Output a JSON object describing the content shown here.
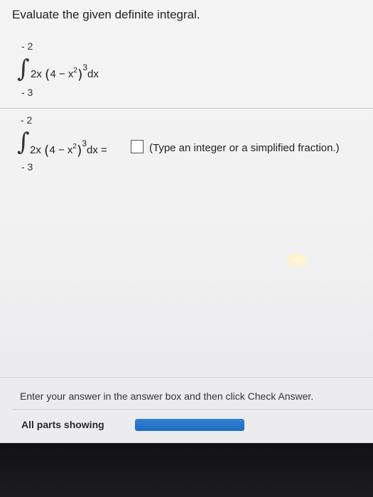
{
  "prompt": "Evaluate the given definite integral.",
  "problem": {
    "upper_limit": "- 2",
    "lower_limit": "- 3",
    "coefficient": "2x",
    "open_paren": "(",
    "inner": "4 − x",
    "inner_exponent": "2",
    "close_paren": ")",
    "outer_exponent": "3",
    "differential": "dx"
  },
  "answer_line": {
    "upper_limit": "- 2",
    "lower_limit": "- 3",
    "coefficient": "2x",
    "open_paren": "(",
    "inner": "4 − x",
    "inner_exponent": "2",
    "close_paren": ")",
    "outer_exponent": "3",
    "differential": "dx =",
    "answer_value": "",
    "hint": "(Type an integer or a simplified fraction.)"
  },
  "footer": {
    "instruction": "Enter your answer in the answer box and then click Check Answer.",
    "parts_label": "All parts showing",
    "progress": 1.0,
    "progress_color": "#1f6cc0"
  },
  "colors": {
    "background": "#f2f2f2",
    "text": "#222222",
    "bezel": "#1a1a1c"
  },
  "icons": {
    "integral": "∫"
  }
}
